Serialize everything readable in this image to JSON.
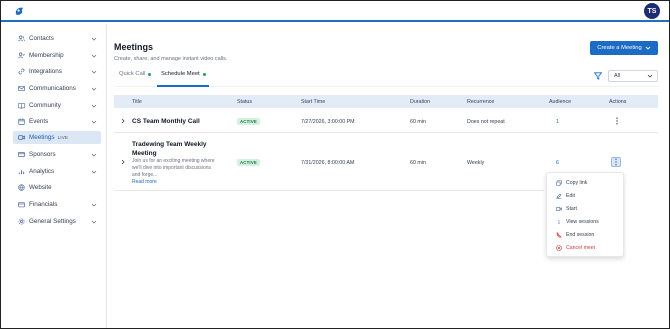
{
  "topbar": {
    "avatar_initials": "TS"
  },
  "sidebar": {
    "items": [
      {
        "label": "Contacts",
        "icon": "users-icon",
        "has_chevron": true
      },
      {
        "label": "Membership",
        "icon": "user-check-icon",
        "has_chevron": true
      },
      {
        "label": "Integrations",
        "icon": "link-icon",
        "has_chevron": true
      },
      {
        "label": "Communications",
        "icon": "mail-icon",
        "has_chevron": true
      },
      {
        "label": "Community",
        "icon": "book-icon",
        "has_chevron": true
      },
      {
        "label": "Events",
        "icon": "calendar-icon",
        "has_chevron": true
      },
      {
        "label": "Meetings",
        "icon": "video-icon",
        "badge": "LIVE",
        "active": true
      },
      {
        "label": "Sponsors",
        "icon": "card-icon",
        "has_chevron": true
      },
      {
        "label": "Analytics",
        "icon": "bar-chart-icon",
        "has_chevron": true
      },
      {
        "label": "Website",
        "icon": "globe-icon",
        "has_chevron": false
      },
      {
        "label": "Financials",
        "icon": "wallet-icon",
        "has_chevron": true
      },
      {
        "label": "General Settings",
        "icon": "gear-icon",
        "has_chevron": true
      }
    ]
  },
  "page": {
    "title": "Meetings",
    "subtitle": "Create, share, and manage instant video calls.",
    "create_button": "Create a Meeting"
  },
  "tabs": [
    {
      "label": "Quick Call",
      "dot_color": "#22a05a"
    },
    {
      "label": "Schedule Meet",
      "dot_color": "#22a05a",
      "active": true
    }
  ],
  "filter": {
    "selected": "All"
  },
  "table": {
    "headers": [
      "Title",
      "Status",
      "Start Time",
      "Duration",
      "Recurrence",
      "Audience",
      "Actions"
    ],
    "rows": [
      {
        "title": "CS Team Monthly Call",
        "status": "ACTIVE",
        "start_time": "7/27/2026, 3:00:00 PM",
        "duration": "60 min",
        "recurrence": "Does not repeat",
        "audience": "1"
      },
      {
        "title_line1": "Tradewing Team Weekly",
        "title_line2": "Meeting",
        "desc_line1": "Join us for an exciting meeting where",
        "desc_line2": "we'll dive into important discussions",
        "desc_line3": "and forge...",
        "read_more": "Read more",
        "status": "ACTIVE",
        "start_time": "7/31/2026, 8:00:00 AM",
        "duration": "60 min",
        "recurrence": "Weekly",
        "audience": "6"
      }
    ]
  },
  "actions_menu": {
    "items": [
      {
        "label": "Copy link",
        "icon": "copy-icon"
      },
      {
        "label": "Edit",
        "icon": "edit-icon"
      },
      {
        "label": "Start",
        "icon": "play-icon"
      },
      {
        "label": "View sessions",
        "icon": "info-icon"
      },
      {
        "label": "End session",
        "icon": "phone-off-icon"
      },
      {
        "label": "Cancel meet",
        "icon": "x-circle-icon",
        "danger": true
      }
    ]
  },
  "colors": {
    "accent": "#1c6bc4",
    "active_badge_bg": "#d4f0df",
    "danger": "#d13b3b"
  }
}
